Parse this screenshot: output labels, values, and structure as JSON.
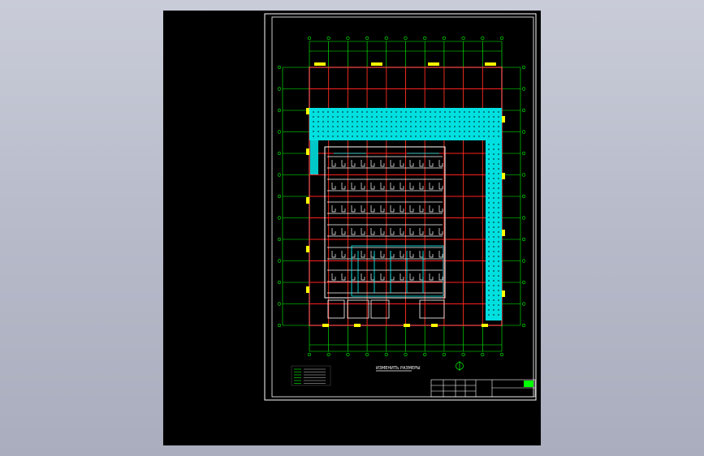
{
  "drawing": {
    "plan_title": "ИЗМЕНИТЬ РАЗМЕРЫ"
  },
  "colors": {
    "background": "#000000",
    "grid": "#00ff00",
    "column_lines": "#ff2020",
    "hvac": "#00ffff",
    "frame": "#ffffff",
    "columns_fill": "#ffff00"
  }
}
